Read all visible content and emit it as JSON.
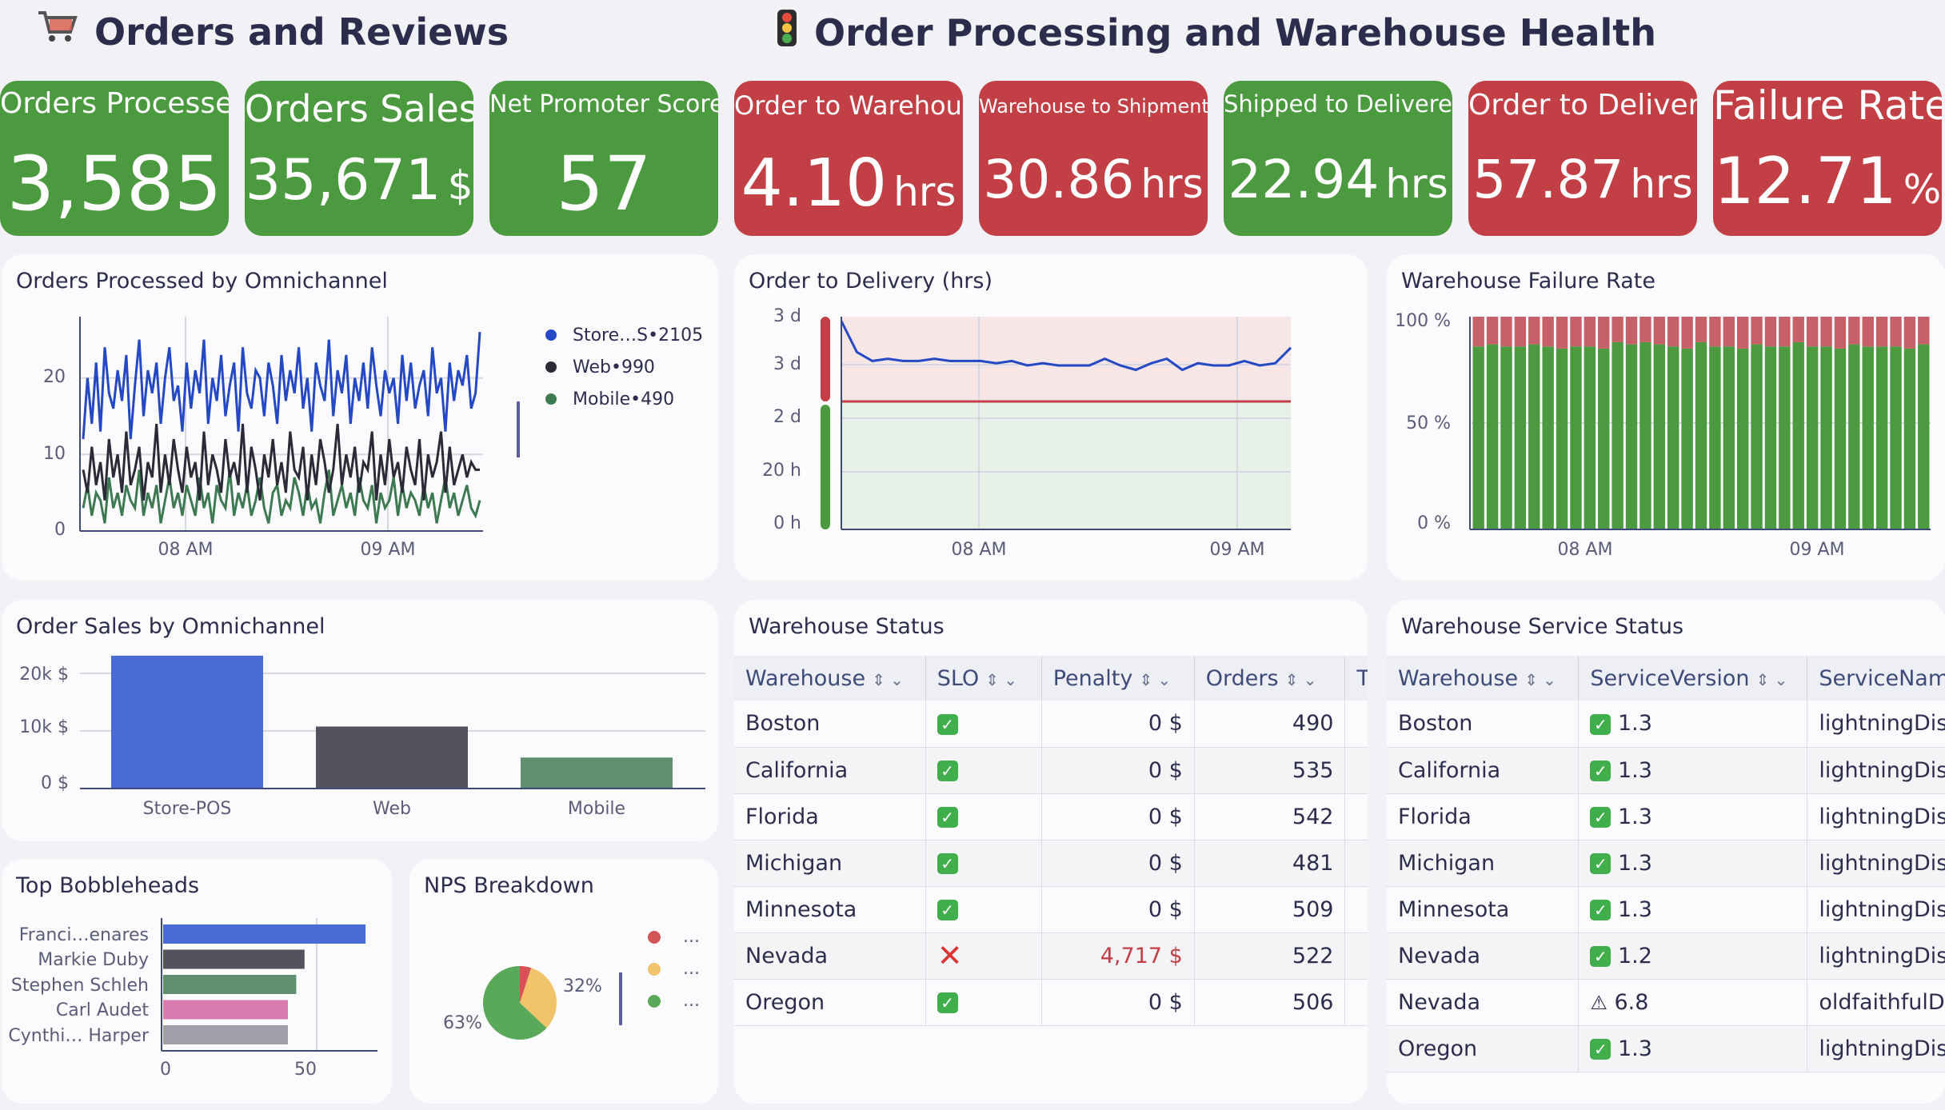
{
  "sections": {
    "left_title": "Orders and Reviews",
    "left_icon": "cart-icon",
    "right_title": "Order Processing and Warehouse Health",
    "right_icon": "traffic-light-icon"
  },
  "tiles": [
    {
      "label": "Orders Processed",
      "value": "3,585",
      "unit": "",
      "status": "green"
    },
    {
      "label": "Orders Sales",
      "value": "35,671",
      "unit": "$",
      "status": "green"
    },
    {
      "label": "Net Promoter Score",
      "value": "57",
      "unit": "",
      "status": "green"
    },
    {
      "label": "Order to Warehouse",
      "value": "4.10",
      "unit": "hrs",
      "status": "red"
    },
    {
      "label": "Warehouse to Shipment",
      "value": "30.86",
      "unit": "hrs",
      "status": "red"
    },
    {
      "label": "Shipped to Delivered",
      "value": "22.94",
      "unit": "hrs",
      "status": "green"
    },
    {
      "label": "Order to Delivery",
      "value": "57.87",
      "unit": "hrs",
      "status": "red"
    },
    {
      "label": "Failure Rate",
      "value": "12.71",
      "unit": "%",
      "status": "red"
    }
  ],
  "colors": {
    "green": "#4c9a3f",
    "red": "#c23f45",
    "store": "#2548c4",
    "web": "#2b2b38",
    "mobile": "#3d7a52",
    "bar_blue": "#4a6ad6",
    "bar_dark": "#52535e",
    "bar_green": "#5e8f6e"
  },
  "panels": {
    "omni_orders": {
      "title": "Orders Processed by Omnichannel",
      "legend": [
        {
          "label": "Store…S•2105",
          "color": "#2548c4"
        },
        {
          "label": "Web•990",
          "color": "#2b2b38"
        },
        {
          "label": "Mobile•490",
          "color": "#3d7a52"
        }
      ]
    },
    "order_delivery": {
      "title": "Order to Delivery (hrs)"
    },
    "failure_rate": {
      "title": "Warehouse Failure Rate"
    },
    "order_sales": {
      "title": "Order Sales by Omnichannel"
    },
    "bobbleheads": {
      "title": "Top Bobbleheads"
    },
    "nps": {
      "title": "NPS Breakdown",
      "legend": [
        "...",
        "...",
        "..."
      ]
    },
    "warehouse_status": {
      "title": "Warehouse Status",
      "columns": [
        "Warehouse",
        "SLO",
        "Penalty",
        "Orders",
        "T"
      ],
      "rows": [
        {
          "warehouse": "Boston",
          "slo": "ok",
          "penalty": "0 $",
          "orders": "490"
        },
        {
          "warehouse": "California",
          "slo": "ok",
          "penalty": "0 $",
          "orders": "535"
        },
        {
          "warehouse": "Florida",
          "slo": "ok",
          "penalty": "0 $",
          "orders": "542"
        },
        {
          "warehouse": "Michigan",
          "slo": "ok",
          "penalty": "0 $",
          "orders": "481"
        },
        {
          "warehouse": "Minnesota",
          "slo": "ok",
          "penalty": "0 $",
          "orders": "509"
        },
        {
          "warehouse": "Nevada",
          "slo": "fail",
          "penalty": "4,717 $",
          "orders": "522"
        },
        {
          "warehouse": "Oregon",
          "slo": "ok",
          "penalty": "0 $",
          "orders": "506"
        }
      ]
    },
    "service_status": {
      "title": "Warehouse Service Status",
      "columns": [
        "Warehouse",
        "ServiceVersion",
        "ServiceNam"
      ],
      "rows": [
        {
          "warehouse": "Boston",
          "state": "ok",
          "version": "1.3",
          "service": "lightningDis"
        },
        {
          "warehouse": "California",
          "state": "ok",
          "version": "1.3",
          "service": "lightningDis"
        },
        {
          "warehouse": "Florida",
          "state": "ok",
          "version": "1.3",
          "service": "lightningDis"
        },
        {
          "warehouse": "Michigan",
          "state": "ok",
          "version": "1.3",
          "service": "lightningDis"
        },
        {
          "warehouse": "Minnesota",
          "state": "ok",
          "version": "1.3",
          "service": "lightningDis"
        },
        {
          "warehouse": "Nevada",
          "state": "ok",
          "version": "1.2",
          "service": "lightningDis"
        },
        {
          "warehouse": "Nevada",
          "state": "warn",
          "version": "6.8",
          "service": "oldfaithfulD"
        },
        {
          "warehouse": "Oregon",
          "state": "ok",
          "version": "1.3",
          "service": "lightningDis"
        }
      ]
    }
  },
  "chart_data": [
    {
      "id": "omni_orders",
      "type": "line",
      "title": "Orders Processed by Omnichannel",
      "x_tick_labels": [
        "08 AM",
        "09 AM"
      ],
      "y_tick_labels": [
        "0",
        "10",
        "20"
      ],
      "ylim": [
        0,
        28
      ],
      "series": [
        {
          "name": "Store…S•2105",
          "color": "#2548c4",
          "values": [
            12,
            20,
            14,
            22,
            13,
            24,
            18,
            16,
            21,
            17,
            23,
            12,
            19,
            25,
            15,
            21,
            18,
            22,
            14,
            20,
            24,
            17,
            19,
            13,
            22,
            16,
            21,
            18,
            25,
            14,
            20,
            17,
            23,
            15,
            19,
            22,
            13,
            24,
            18,
            16,
            21,
            20,
            15,
            22,
            19,
            14,
            23,
            17,
            21,
            18,
            24,
            16,
            20,
            13,
            22,
            19,
            17,
            25,
            15,
            21,
            18,
            23,
            14,
            20,
            17,
            22,
            16,
            24,
            19,
            15,
            21,
            18,
            20,
            14,
            23,
            17,
            22,
            16,
            19,
            21,
            15,
            24,
            18,
            20,
            13,
            22,
            17,
            21,
            19,
            23,
            16,
            18,
            26
          ]
        },
        {
          "name": "Web•990",
          "color": "#2b2b38",
          "values": [
            8,
            5,
            11,
            6,
            9,
            4,
            12,
            7,
            10,
            5,
            13,
            6,
            8,
            11,
            4,
            9,
            7,
            14,
            5,
            10,
            6,
            12,
            8,
            5,
            11,
            7,
            9,
            4,
            13,
            6,
            10,
            8,
            5,
            12,
            7,
            9,
            6,
            14,
            5,
            11,
            8,
            4,
            10,
            7,
            12,
            6,
            9,
            5,
            13,
            8,
            7,
            11,
            4,
            10,
            6,
            12,
            9,
            5,
            8,
            14,
            6,
            10,
            7,
            11,
            5,
            9,
            8,
            13,
            4,
            10,
            6,
            12,
            7,
            9,
            5,
            11,
            8,
            6,
            12,
            4,
            10,
            7,
            9,
            13,
            5,
            11,
            6,
            8,
            10,
            7,
            9,
            8,
            8
          ]
        },
        {
          "name": "Mobile•490",
          "color": "#3d7a52",
          "values": [
            3,
            6,
            2,
            5,
            4,
            1,
            7,
            3,
            5,
            2,
            6,
            4,
            3,
            8,
            2,
            5,
            3,
            6,
            1,
            4,
            7,
            3,
            5,
            2,
            6,
            4,
            2,
            7,
            3,
            5,
            1,
            6,
            4,
            3,
            8,
            2,
            5,
            3,
            6,
            2,
            4,
            7,
            3,
            1,
            5,
            6,
            2,
            4,
            3,
            7,
            5,
            2,
            6,
            3,
            4,
            1,
            5,
            8,
            2,
            4,
            6,
            3,
            5,
            2,
            7,
            4,
            3,
            6,
            1,
            5,
            3,
            4,
            7,
            2,
            6,
            3,
            5,
            4,
            2,
            6,
            3,
            5,
            1,
            4,
            7,
            3,
            5,
            2,
            4,
            6,
            3,
            2,
            4
          ]
        }
      ]
    },
    {
      "id": "order_delivery",
      "type": "line",
      "title": "Order to Delivery (hrs)",
      "x_tick_labels": [
        "08 AM",
        "09 AM"
      ],
      "y_tick_labels": [
        "0 h",
        "20 h",
        "2 d",
        "3 d",
        "3 d"
      ],
      "ylim": [
        0,
        96
      ],
      "threshold": 55,
      "series": [
        {
          "name": "",
          "color": "#2548c4",
          "values": [
            94,
            80,
            76,
            77,
            76,
            76,
            77,
            76,
            76,
            76,
            75,
            76,
            74,
            75,
            74,
            74,
            74,
            77,
            74,
            72,
            75,
            77,
            72,
            75,
            74,
            74,
            76,
            74,
            75,
            82
          ]
        }
      ]
    },
    {
      "id": "failure_rate",
      "type": "bar",
      "title": "Warehouse Failure Rate",
      "x_tick_labels": [
        "08 AM",
        "09 AM"
      ],
      "y_tick_labels": [
        "0 %",
        "50 %",
        "100 %"
      ],
      "ylim": [
        0,
        100
      ],
      "series": [
        {
          "name": "",
          "color": "#4c9a3f",
          "values": [
            86,
            87,
            86,
            86,
            87,
            86,
            85,
            86,
            86,
            85,
            88,
            87,
            88,
            87,
            86,
            85,
            88,
            86,
            86,
            85,
            87,
            86,
            86,
            88,
            86,
            86,
            85,
            87,
            86,
            86,
            86,
            85,
            87
          ]
        },
        {
          "name": "",
          "color": "#c76169",
          "values": [
            14,
            13,
            14,
            14,
            13,
            14,
            15,
            14,
            14,
            15,
            12,
            13,
            12,
            13,
            14,
            15,
            12,
            14,
            14,
            15,
            13,
            14,
            14,
            12,
            14,
            14,
            15,
            13,
            14,
            14,
            14,
            15,
            13
          ]
        }
      ]
    },
    {
      "id": "order_sales",
      "type": "bar",
      "title": "Order Sales by Omnichannel",
      "categories": [
        "Store-POS",
        "Web",
        "Mobile"
      ],
      "values": [
        21000,
        9800,
        4900
      ],
      "colors": [
        "#4a6ad6",
        "#52535e",
        "#5e8f6e"
      ],
      "y_tick_labels": [
        "0 $",
        "10k $",
        "20k $"
      ],
      "ylim": [
        0,
        22000
      ]
    },
    {
      "id": "bobbleheads",
      "type": "bar",
      "title": "Top Bobbleheads",
      "categories": [
        "Franci…enares",
        "Markie Duby",
        "Stephen Schleh",
        "Carl Audet",
        "Cynthi… Harper"
      ],
      "values": [
        73,
        51,
        48,
        45,
        45
      ],
      "colors": [
        "#4a6ad6",
        "#52535e",
        "#5e8f6e",
        "#d87bb0",
        "#a0a0aa"
      ],
      "x_tick_labels": [
        "0",
        "50"
      ],
      "xlim": [
        0,
        75
      ]
    },
    {
      "id": "nps",
      "type": "pie",
      "title": "NPS Breakdown",
      "labels": [
        "63%",
        "32%"
      ],
      "values": [
        63,
        32,
        5
      ],
      "colors": [
        "#5aa95a",
        "#f2c46a",
        "#d45555"
      ]
    }
  ]
}
